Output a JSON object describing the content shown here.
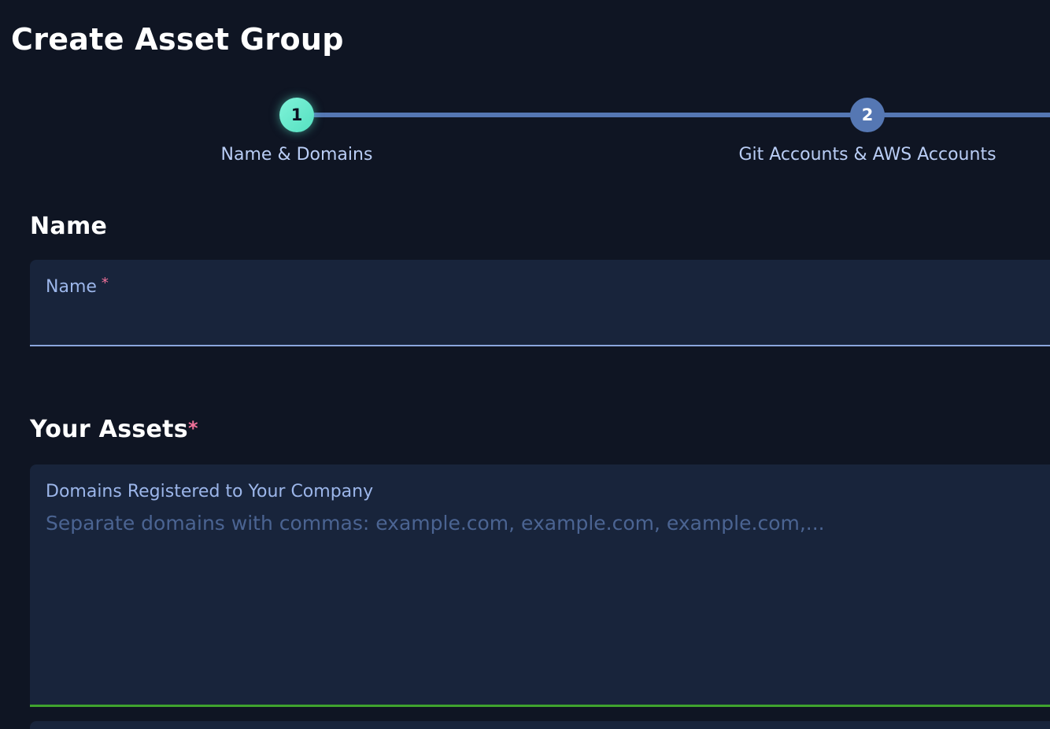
{
  "page": {
    "title": "Create Asset Group"
  },
  "stepper": {
    "steps": [
      {
        "number": "1",
        "label": "Name & Domains",
        "active": true
      },
      {
        "number": "2",
        "label": "Git Accounts & AWS Accounts",
        "active": false
      }
    ]
  },
  "name_section": {
    "heading": "Name",
    "field_label": "Name",
    "required_mark": "*",
    "value": ""
  },
  "assets_section": {
    "heading": "Your Assets",
    "required_mark": "*",
    "domains_label": "Domains Registered to Your Company",
    "domains_placeholder": "Separate domains with commas: example.com, example.com, example.com,...",
    "domains_value": ""
  },
  "colors": {
    "background": "#0f1523",
    "field_background": "#18243b",
    "active_step": "#5fe6c8",
    "inactive_step": "#5577b3",
    "label_text": "#9cb6ea",
    "required": "#f2729a",
    "focus_underline": "#3fa32e"
  }
}
